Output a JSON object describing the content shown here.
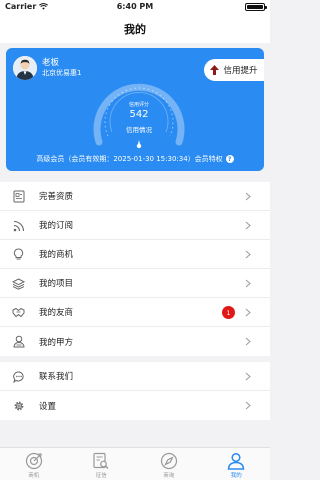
{
  "status_bar": {
    "carrier": "Carrier",
    "time": "6:40 PM"
  },
  "nav": {
    "title": "我的"
  },
  "profile": {
    "name": "老板",
    "company": "北京优易惠1",
    "credit_button": "信用提升",
    "gauge": {
      "title": "信用评分",
      "score": "542",
      "status": "信用情况"
    },
    "member_info": "高级会员（会员有效期：2025-01-30 15:30:34）会员特权"
  },
  "menu_group_1": [
    {
      "label": "完善资质",
      "icon": "document-icon"
    },
    {
      "label": "我的订阅",
      "icon": "rss-icon"
    },
    {
      "label": "我的商机",
      "icon": "lightbulb-icon"
    },
    {
      "label": "我的项目",
      "icon": "layers-icon"
    },
    {
      "label": "我的友商",
      "icon": "handshake-icon",
      "badge": "1"
    },
    {
      "label": "我的甲方",
      "icon": "person-icon"
    }
  ],
  "menu_group_2": [
    {
      "label": "联系我们",
      "icon": "chat-icon"
    },
    {
      "label": "设置",
      "icon": "gear-icon"
    }
  ],
  "tab_bar": [
    {
      "label": "商机",
      "icon": "target-icon",
      "active": false
    },
    {
      "label": "征信",
      "icon": "search-doc-icon",
      "active": false
    },
    {
      "label": "商询",
      "icon": "compass-icon",
      "active": false
    },
    {
      "label": "我的",
      "icon": "user-icon",
      "active": true
    }
  ],
  "colors": {
    "accent": "#2a8bf2",
    "badge": "#e21818",
    "background": "#f2f2f4"
  }
}
